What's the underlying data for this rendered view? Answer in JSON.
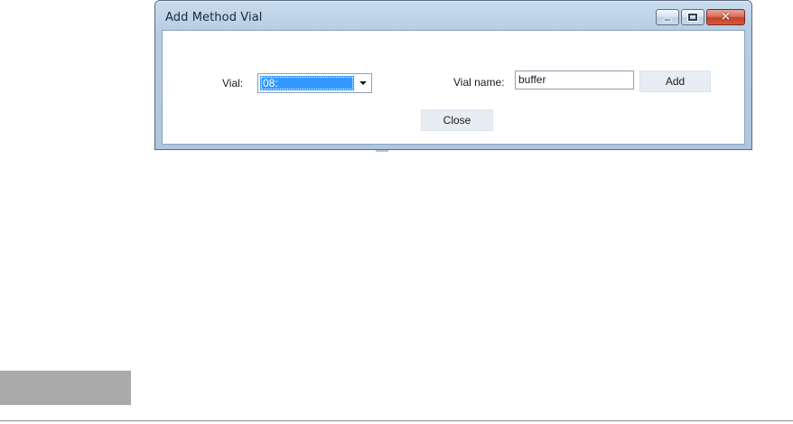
{
  "window": {
    "title": "Add Method Vial",
    "minimize_icon": "minimize-icon",
    "maximize_icon": "maximize-icon",
    "close_icon": "close-icon",
    "close_glyph": "✕"
  },
  "form": {
    "vial_label": "Vial:",
    "vial_selected": "08:",
    "vial_name_label": "Vial name:",
    "vial_name_value": "buffer",
    "add_label": "Add",
    "close_label": "Close"
  },
  "colors": {
    "selection": "#3399ff",
    "close_button": "#c4422a",
    "frame": "#b7cde4"
  }
}
